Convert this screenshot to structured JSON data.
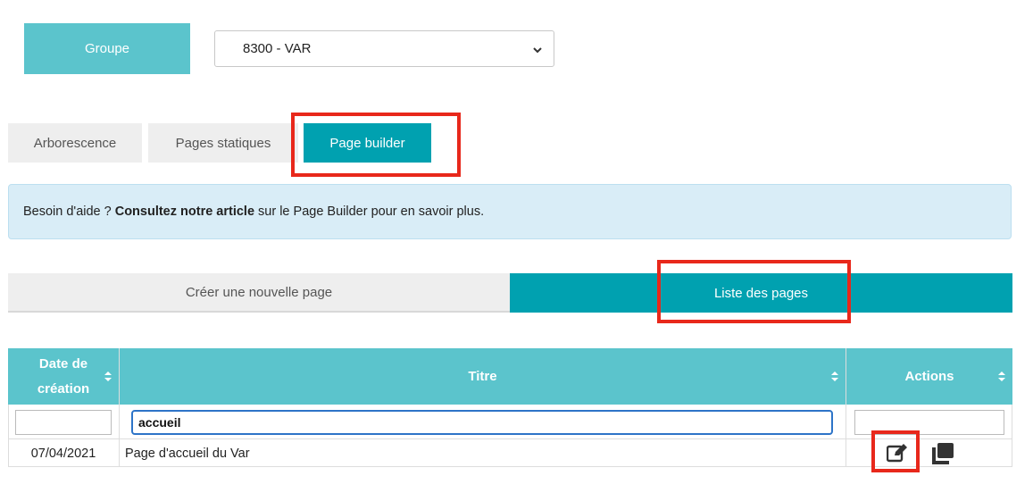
{
  "groupe": {
    "label": "Groupe",
    "selected": "8300 - VAR"
  },
  "tabs": [
    {
      "label": "Arborescence",
      "active": false
    },
    {
      "label": "Pages statiques",
      "active": false
    },
    {
      "label": "Page builder",
      "active": true
    }
  ],
  "alert": {
    "prefix": "Besoin d'aide ?",
    "bold": "Consultez notre article",
    "suffix": "sur le Page Builder pour en savoir plus."
  },
  "subtabs": [
    {
      "label": "Créer une nouvelle page",
      "active": false
    },
    {
      "label": "Liste des pages",
      "active": true
    }
  ],
  "table": {
    "headers": {
      "date_line1": "Date de",
      "date_line2": "création",
      "titre": "Titre",
      "actions": "Actions"
    },
    "filters": {
      "date": "",
      "titre": "accueil",
      "actions": ""
    },
    "rows": [
      {
        "date": "07/04/2021",
        "titre": "Page d'accueil du Var"
      }
    ]
  },
  "icons": {
    "select_chevron": "chevron-down-icon",
    "sort": "sort-icon",
    "edit": "edit-icon",
    "copy": "copy-icon"
  },
  "colors": {
    "accent": "#00a1b0",
    "header": "#5bc4cc",
    "highlight": "#e8281b",
    "alert_bg": "#d9edf7"
  }
}
